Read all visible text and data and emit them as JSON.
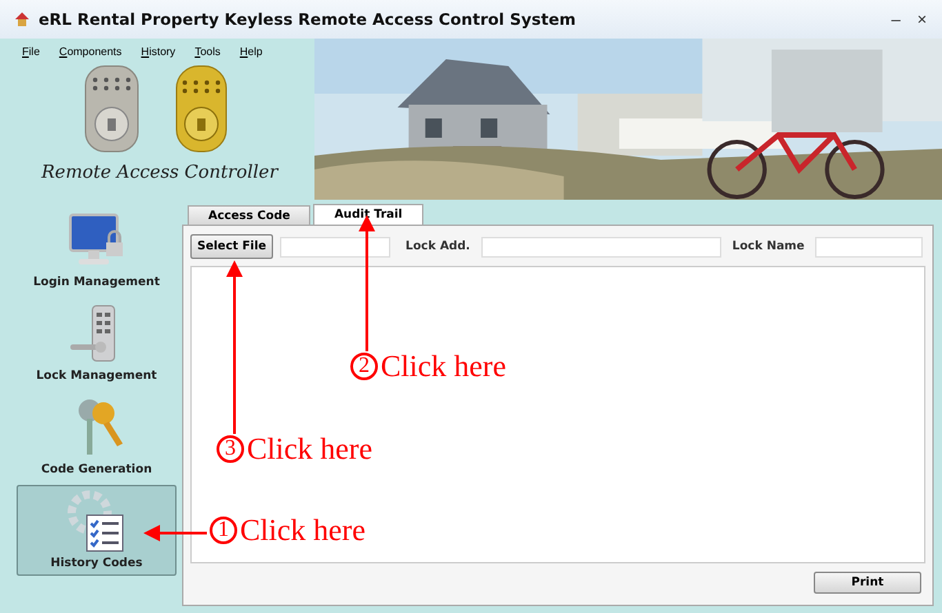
{
  "window": {
    "title": "eRL Rental Property Keyless Remote Access Control System",
    "controls": [
      "–",
      "×"
    ]
  },
  "menu": [
    "File",
    "Components",
    "History",
    "Tools",
    "Help"
  ],
  "logo": {
    "text": "Remote Access Controller"
  },
  "sidebar": {
    "items": [
      {
        "label": "Login Management",
        "kind": "monitor",
        "selected": false
      },
      {
        "label": "Lock Management",
        "kind": "lock",
        "selected": false
      },
      {
        "label": "Code Generation",
        "kind": "keys",
        "selected": false
      },
      {
        "label": "History Codes",
        "kind": "history",
        "selected": true
      }
    ]
  },
  "tabs": [
    {
      "label": "Access Code",
      "selected": false
    },
    {
      "label": "Audit Trail",
      "selected": true
    }
  ],
  "toolbar": {
    "select_button": "Select File",
    "lock_add_label": "Lock Add.",
    "lock_name_label": "Lock Name"
  },
  "print_button": "Print",
  "annotations": [
    {
      "number": "1",
      "text": "Click here",
      "kind": "left"
    },
    {
      "number": "2",
      "text": "Click here",
      "kind": "up"
    },
    {
      "number": "3",
      "text": "Click here",
      "kind": "up"
    }
  ]
}
